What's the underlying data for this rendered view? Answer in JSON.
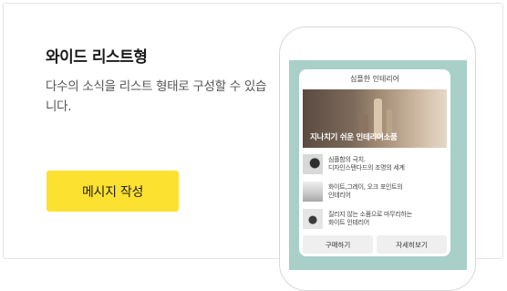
{
  "panel": {
    "title": "와이드 리스트형",
    "description": "다수의 소식을 리스트 형태로 구성할 수 있습니다.",
    "cta_label": "메시지 작성"
  },
  "preview": {
    "header": "심플한 인테리어",
    "hero_caption": "지나치기 쉬운 인테리어소품",
    "items": [
      {
        "text": "심플함의 극치.\n디자인스탠다드의 조명의 세계"
      },
      {
        "text": "화이트,그레이, 오크 포인트의\n인테리어"
      },
      {
        "text": "질리지 않는 소품으로 마무리하는\n화이트 인테리어"
      }
    ],
    "buttons": [
      "구매하기",
      "자세히보기"
    ]
  },
  "colors": {
    "cta_background": "#fce130",
    "phone_screen": "#a9cfc9"
  }
}
